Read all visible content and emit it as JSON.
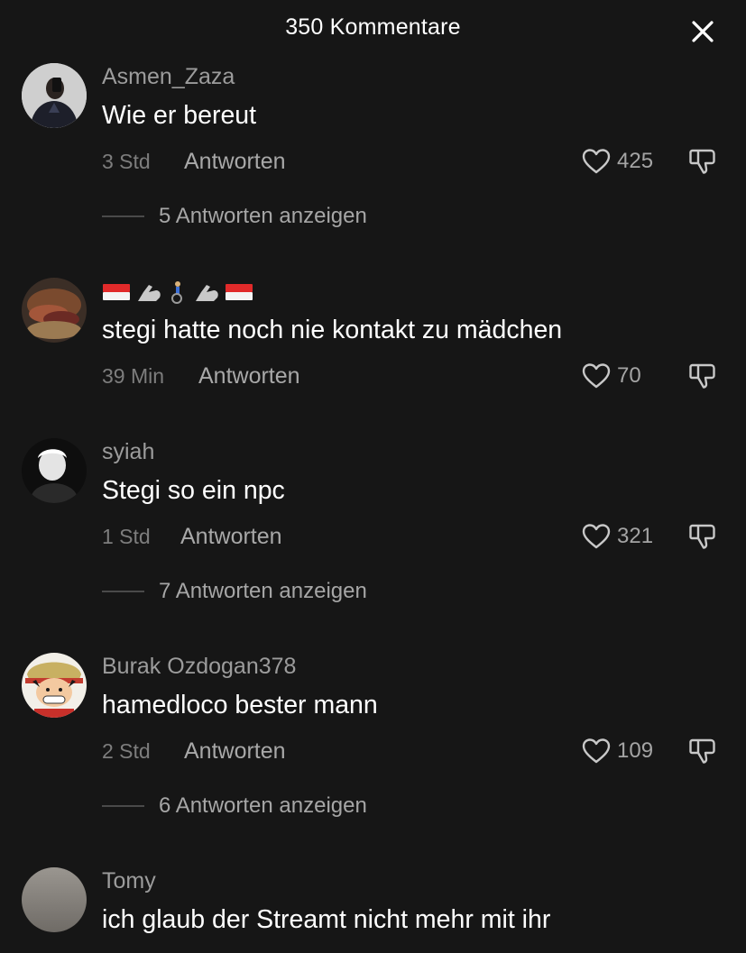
{
  "header": {
    "title": "350 Kommentare"
  },
  "comments": [
    {
      "username": "Asmen_Zaza",
      "text": "Wie er bereut",
      "time": "3 Std",
      "reply_label": "Antworten",
      "likes": "425",
      "view_replies": "5 Antworten anzeigen"
    },
    {
      "username_emojis": [
        "flag-id",
        "flexed-biceps",
        "person-in-wheelchair",
        "flexed-biceps",
        "flag-id"
      ],
      "text": "stegi hatte noch nie kontakt zu mädchen",
      "time": "39 Min",
      "reply_label": "Antworten",
      "likes": "70"
    },
    {
      "username": "syiah",
      "text": "Stegi so ein npc",
      "time": "1 Std",
      "reply_label": "Antworten",
      "likes": "321",
      "view_replies": "7 Antworten anzeigen"
    },
    {
      "username": "Burak Ozdogan378",
      "text": "hamedloco bester mann",
      "time": "2 Std",
      "reply_label": "Antworten",
      "likes": "109",
      "view_replies": "6 Antworten anzeigen"
    },
    {
      "username": "Tomy",
      "text": "ich glaub der Streamt nicht mehr mit ihr"
    }
  ],
  "colors": {
    "background": "#161616",
    "text_primary": "#ffffff",
    "text_secondary": "#9c9c9c",
    "divider": "#4a4a4a"
  }
}
